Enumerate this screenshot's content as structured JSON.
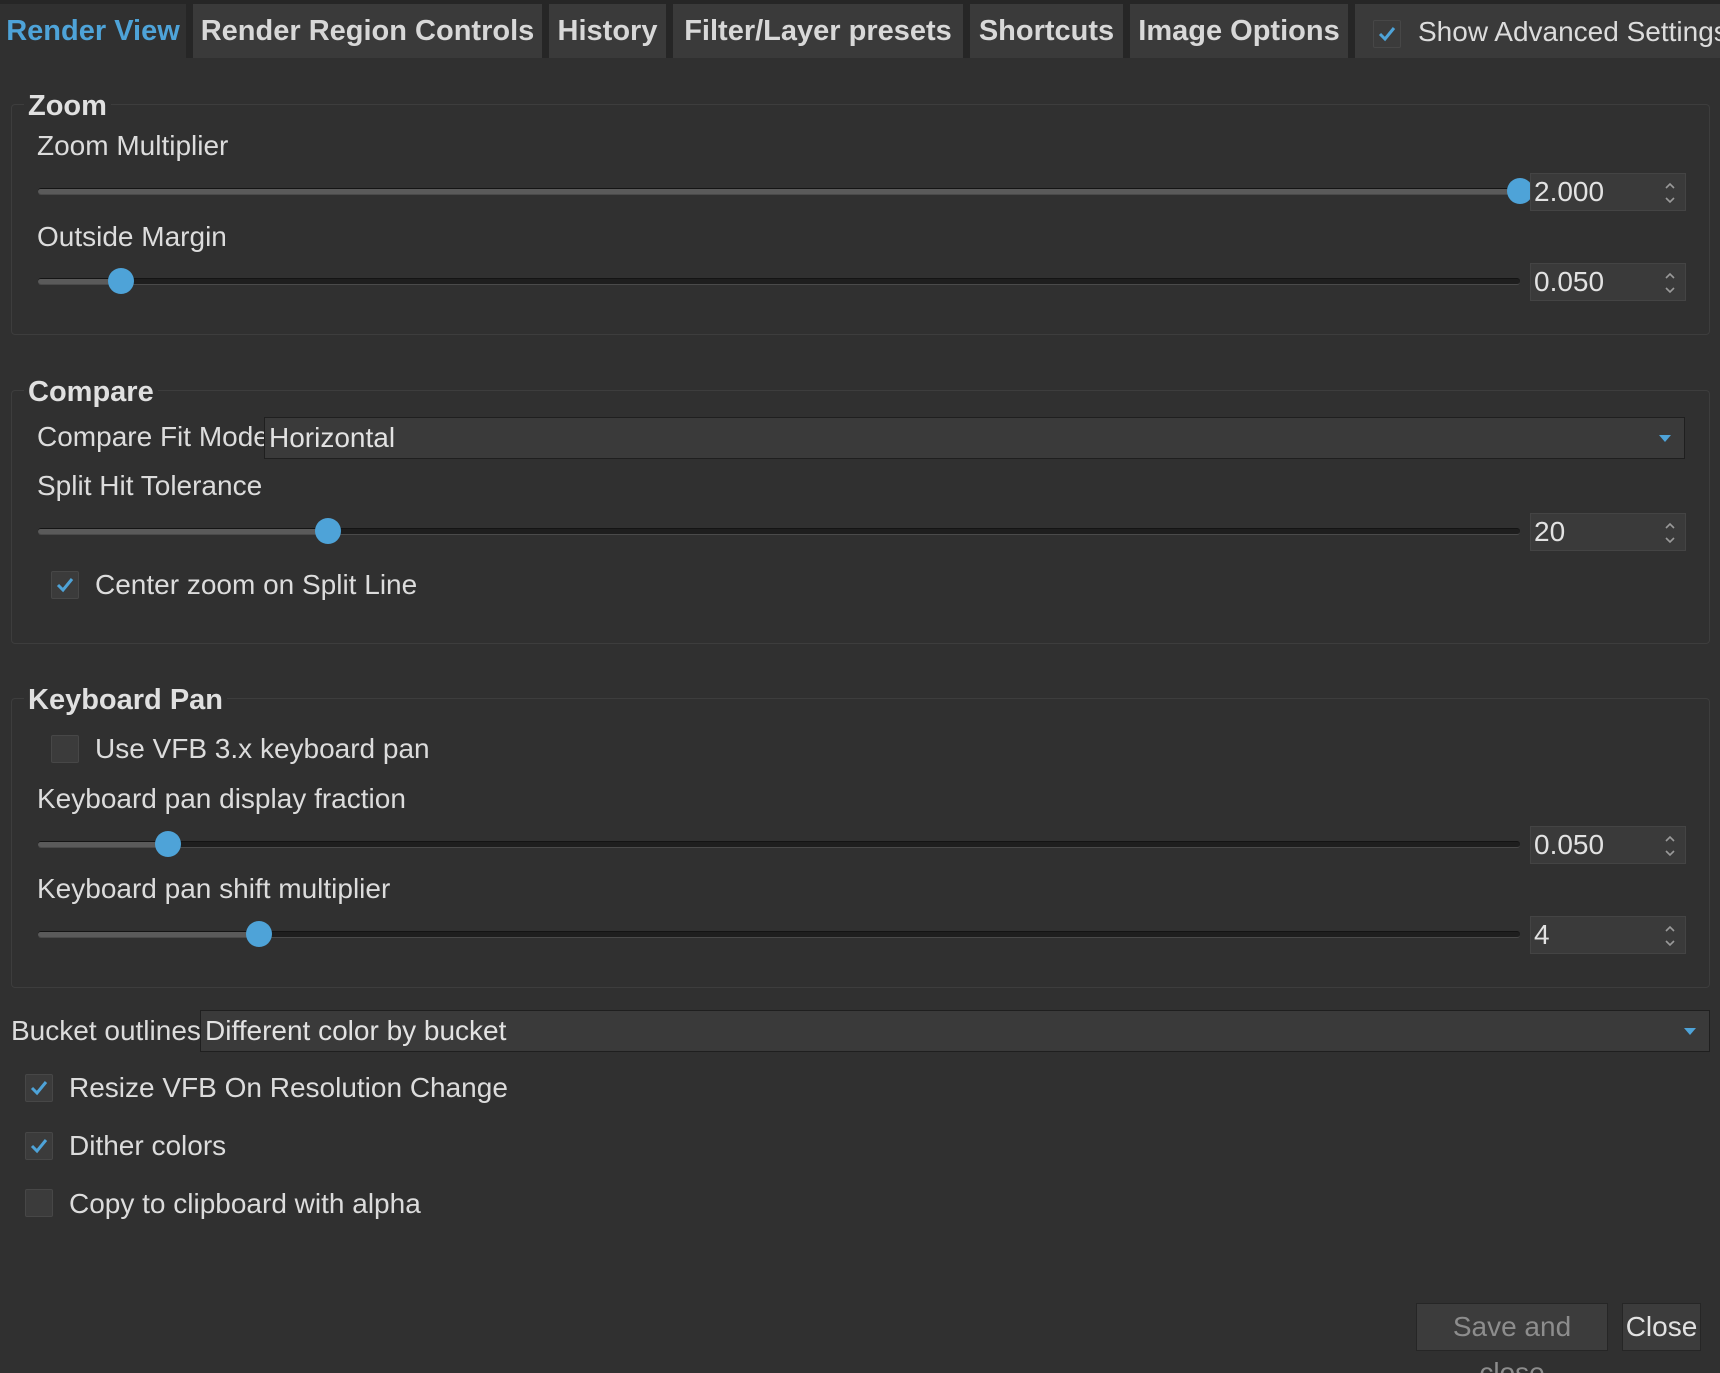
{
  "tabs": [
    {
      "label": "Render View",
      "active": true
    },
    {
      "label": "Render Region Controls",
      "active": false
    },
    {
      "label": "History",
      "active": false
    },
    {
      "label": "Filter/Layer presets",
      "active": false
    },
    {
      "label": "Shortcuts",
      "active": false
    },
    {
      "label": "Image Options",
      "active": false
    }
  ],
  "show_advanced": {
    "label": "Show Advanced Settings",
    "checked": true
  },
  "zoom": {
    "title": "Zoom",
    "multiplier": {
      "label": "Zoom Multiplier",
      "value": "2.000",
      "fraction": 1.0
    },
    "outside_margin": {
      "label": "Outside Margin",
      "value": "0.050",
      "fraction": 0.056
    }
  },
  "compare": {
    "title": "Compare",
    "fit_mode": {
      "label": "Compare Fit Mode",
      "value": "Horizontal"
    },
    "split_hit_tolerance": {
      "label": "Split Hit Tolerance",
      "value": "20",
      "fraction": 0.196
    },
    "center_zoom": {
      "label": "Center zoom on Split Line",
      "checked": true
    }
  },
  "keyboard_pan": {
    "title": "Keyboard Pan",
    "use_vfb3": {
      "label": "Use VFB 3.x keyboard pan",
      "checked": false
    },
    "display_fraction": {
      "label": "Keyboard pan display fraction",
      "value": "0.050",
      "fraction": 0.088
    },
    "shift_multiplier": {
      "label": "Keyboard pan shift multiplier",
      "value": "4",
      "fraction": 0.149
    }
  },
  "bucket_outlines": {
    "label": "Bucket outlines",
    "value": "Different color by bucket"
  },
  "options": {
    "resize_vfb": {
      "label": "Resize VFB On Resolution Change",
      "checked": true
    },
    "dither": {
      "label": "Dither colors",
      "checked": true
    },
    "copy_alpha": {
      "label": "Copy to clipboard with alpha",
      "checked": false
    }
  },
  "buttons": {
    "save_close": "Save and close",
    "close": "Close"
  },
  "colors": {
    "accent": "#4ea3d8",
    "background": "#303030",
    "tab_inactive": "#3a3a3a"
  }
}
